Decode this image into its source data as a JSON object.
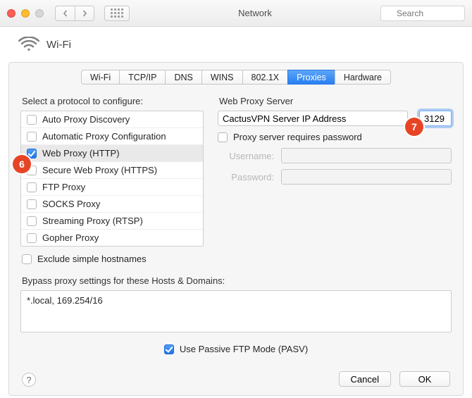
{
  "window": {
    "title": "Network",
    "search_placeholder": "Search"
  },
  "header": {
    "title": "Wi-Fi"
  },
  "tabs": [
    "Wi-Fi",
    "TCP/IP",
    "DNS",
    "WINS",
    "802.1X",
    "Proxies",
    "Hardware"
  ],
  "active_tab_index": 5,
  "left": {
    "label": "Select a protocol to configure:",
    "protocols": [
      {
        "label": "Auto Proxy Discovery",
        "checked": false,
        "selected": false
      },
      {
        "label": "Automatic Proxy Configuration",
        "checked": false,
        "selected": false
      },
      {
        "label": "Web Proxy (HTTP)",
        "checked": true,
        "selected": true
      },
      {
        "label": "Secure Web Proxy (HTTPS)",
        "checked": false,
        "selected": false
      },
      {
        "label": "FTP Proxy",
        "checked": false,
        "selected": false
      },
      {
        "label": "SOCKS Proxy",
        "checked": false,
        "selected": false
      },
      {
        "label": "Streaming Proxy (RTSP)",
        "checked": false,
        "selected": false
      },
      {
        "label": "Gopher Proxy",
        "checked": false,
        "selected": false
      }
    ],
    "exclude_label": "Exclude simple hostnames",
    "exclude_checked": false
  },
  "right": {
    "label": "Web Proxy Server",
    "server_value": "CactusVPN Server IP Address",
    "sep": ":",
    "port_value": "3129",
    "requires_pw_label": "Proxy server requires password",
    "requires_pw_checked": false,
    "username_label": "Username:",
    "password_label": "Password:"
  },
  "bypass": {
    "label": "Bypass proxy settings for these Hosts & Domains:",
    "value": "*.local, 169.254/16"
  },
  "passive": {
    "label": "Use Passive FTP Mode (PASV)",
    "checked": true
  },
  "footer": {
    "cancel": "Cancel",
    "ok": "OK"
  },
  "annotations": {
    "n6": "6",
    "n7": "7"
  }
}
